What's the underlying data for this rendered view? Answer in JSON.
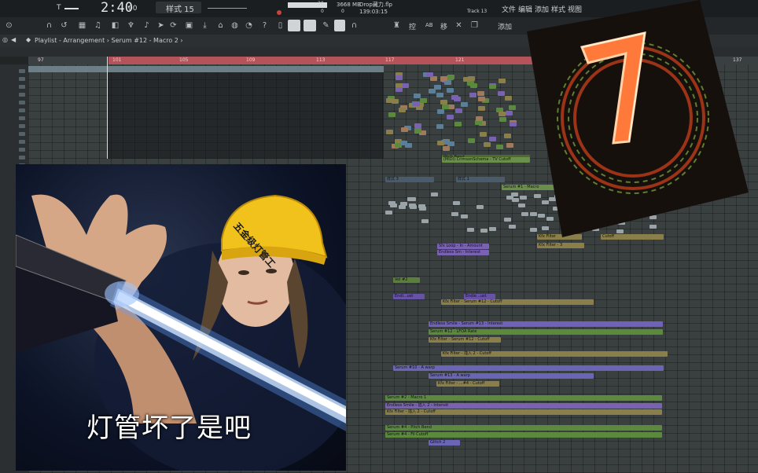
{
  "topbar": {
    "t_label": "T",
    "time": "2:40",
    "time_sub": "00",
    "pattern": "样式 15",
    "cpu_top": "20",
    "cpu_bot": "0",
    "memory": "3668 MB",
    "mem_sub": "0",
    "file_name": "Drop藏力.flp",
    "file_time": "139:03:15",
    "track_label": "Track 13",
    "menu": [
      "文件",
      "编辑",
      "添加",
      "样式",
      "视图"
    ]
  },
  "toolbar": {
    "right_labels": [
      "控",
      "AB",
      "移",
      "添加"
    ]
  },
  "breadcrumb": "Playlist - Arrangement › Serum #12 - Macro 2 ›",
  "timeline_numbers": [
    "97",
    "101",
    "105",
    "109",
    "113",
    "117",
    "121",
    "125",
    "137"
  ],
  "clips": [
    {
      "label": "Pitch Bend",
      "color": "#4f6a2e"
    },
    {
      "label": "(MIDI) CrimsonSchema - TV Cutoff",
      "color": "#6a8f4a"
    },
    {
      "label": "样式 3",
      "color": "#4a5b6b"
    },
    {
      "label": "样式 1",
      "color": "#4a5b6b"
    },
    {
      "label": "Serum #1 - Macro",
      "color": "#6a8f4a"
    },
    {
      "label": "Kfx Filter",
      "color": "#8a7e4a"
    },
    {
      "label": "Cutoff",
      "color": "#8a7e4a"
    },
    {
      "label": "Sfx Loop - In - Amount",
      "color": "#7a62b2"
    },
    {
      "label": "Endless Sm - Interest",
      "color": "#7a62b2"
    },
    {
      "label": "Kfx Filter - 3",
      "color": "#8a7e4a"
    },
    {
      "label": "Vol #2",
      "color": "#5a7f3a"
    },
    {
      "label": "Endl...ust",
      "color": "#6653a8"
    },
    {
      "label": "Endle...ust",
      "color": "#6653a8"
    },
    {
      "label": "Kfx Filter - Serum #12 - Cutoff",
      "color": "#8a7e4a"
    },
    {
      "label": "Endless Smile - Serum #13 - Interest",
      "color": "#7061bb"
    },
    {
      "label": "Serum #12 - LFOA Rate",
      "color": "#5a8a3a"
    },
    {
      "label": "Kfx Filter - Serum #12 - Cutoff",
      "color": "#8a7e4a"
    },
    {
      "label": "Kfx Filter - 插入 2 - Cutoff",
      "color": "#8a7e4a"
    },
    {
      "label": "Serum #10 - A warp",
      "color": "#6a65b5"
    },
    {
      "label": "Serum #13 - A warp",
      "color": "#6a65b5"
    },
    {
      "label": "Kfx Filter - ...#4 - Cutoff",
      "color": "#8a7e4a"
    },
    {
      "label": "Serum #2 - Macro 1",
      "color": "#5b8a3e"
    },
    {
      "label": "Endless Smile - 插入 2 - Intensit",
      "color": "#7a62b2"
    },
    {
      "label": "Kfx Filter - 插入 2 - Cutoff",
      "color": "#8a7e4a"
    },
    {
      "label": "Serum #4 - Pitch Bend",
      "color": "#5b8a3e"
    },
    {
      "label": "Serum #4 - Fil Cutoff",
      "color": "#5b8a3e"
    },
    {
      "label": "Glitch 2",
      "color": "#6a65b5"
    }
  ],
  "meme": {
    "helmet_text": "五金级灯管工",
    "caption": "灯管坏了是吧"
  },
  "colors": {
    "background": "#222526",
    "loop": "#b4535a",
    "grid": "#3a3f40",
    "helmet": "#f2c21c",
    "lightsaber": "#e8f4ff"
  }
}
